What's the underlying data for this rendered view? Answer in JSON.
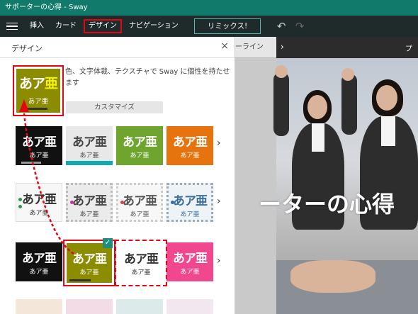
{
  "title_bar": {
    "text": "サポーターの心得 - Sway"
  },
  "toolbar": {
    "items": [
      "挿入",
      "カード",
      "デザイン",
      "ナビゲーション"
    ],
    "remix_label": "リミックス!",
    "undo_icon": "undo-icon",
    "redo_icon": "redo-icon"
  },
  "storyline": {
    "label": "ーライン"
  },
  "preview": {
    "header_prefix": "プ",
    "title": "ーターの心得"
  },
  "design_panel": {
    "title": "デザイン",
    "close": "×",
    "description": "色、文字体裁、テクスチャで Sway に個性を持たせます",
    "customize_label": "カスタマイズ",
    "current_style": {
      "big_a": "あア",
      "big_b": "亜",
      "small": "あア亜"
    },
    "rows": [
      [
        {
          "big": "あア亜",
          "small": "あア亜"
        },
        {
          "big": "あア亜",
          "small": "あア亜"
        },
        {
          "big": "あア亜",
          "small": "あア亜"
        },
        {
          "big": "あア亜",
          "small": "あア亜"
        }
      ],
      [
        {
          "big": "あア亜",
          "small": "あア亜"
        },
        {
          "big": "あア亜",
          "small": "あア亜"
        },
        {
          "big": "あア亜",
          "small": "あア亜"
        },
        {
          "big": "あア亜",
          "small": "あア亜"
        }
      ],
      [
        {
          "big": "あア亜",
          "small": "あア亜"
        },
        {
          "big": "あア亜",
          "small": "あア亜"
        },
        {
          "big": "あア亜",
          "small": "あア亜"
        },
        {
          "big": "あア亜",
          "small": "あア亜"
        }
      ]
    ],
    "more_arrow": "›",
    "checkmark": "✓"
  },
  "colors": {
    "accent_teal": "#117a6b",
    "toolbar_bg": "#1f2a2b",
    "highlight_red": "#e30613",
    "olive": "#8c8c00"
  }
}
